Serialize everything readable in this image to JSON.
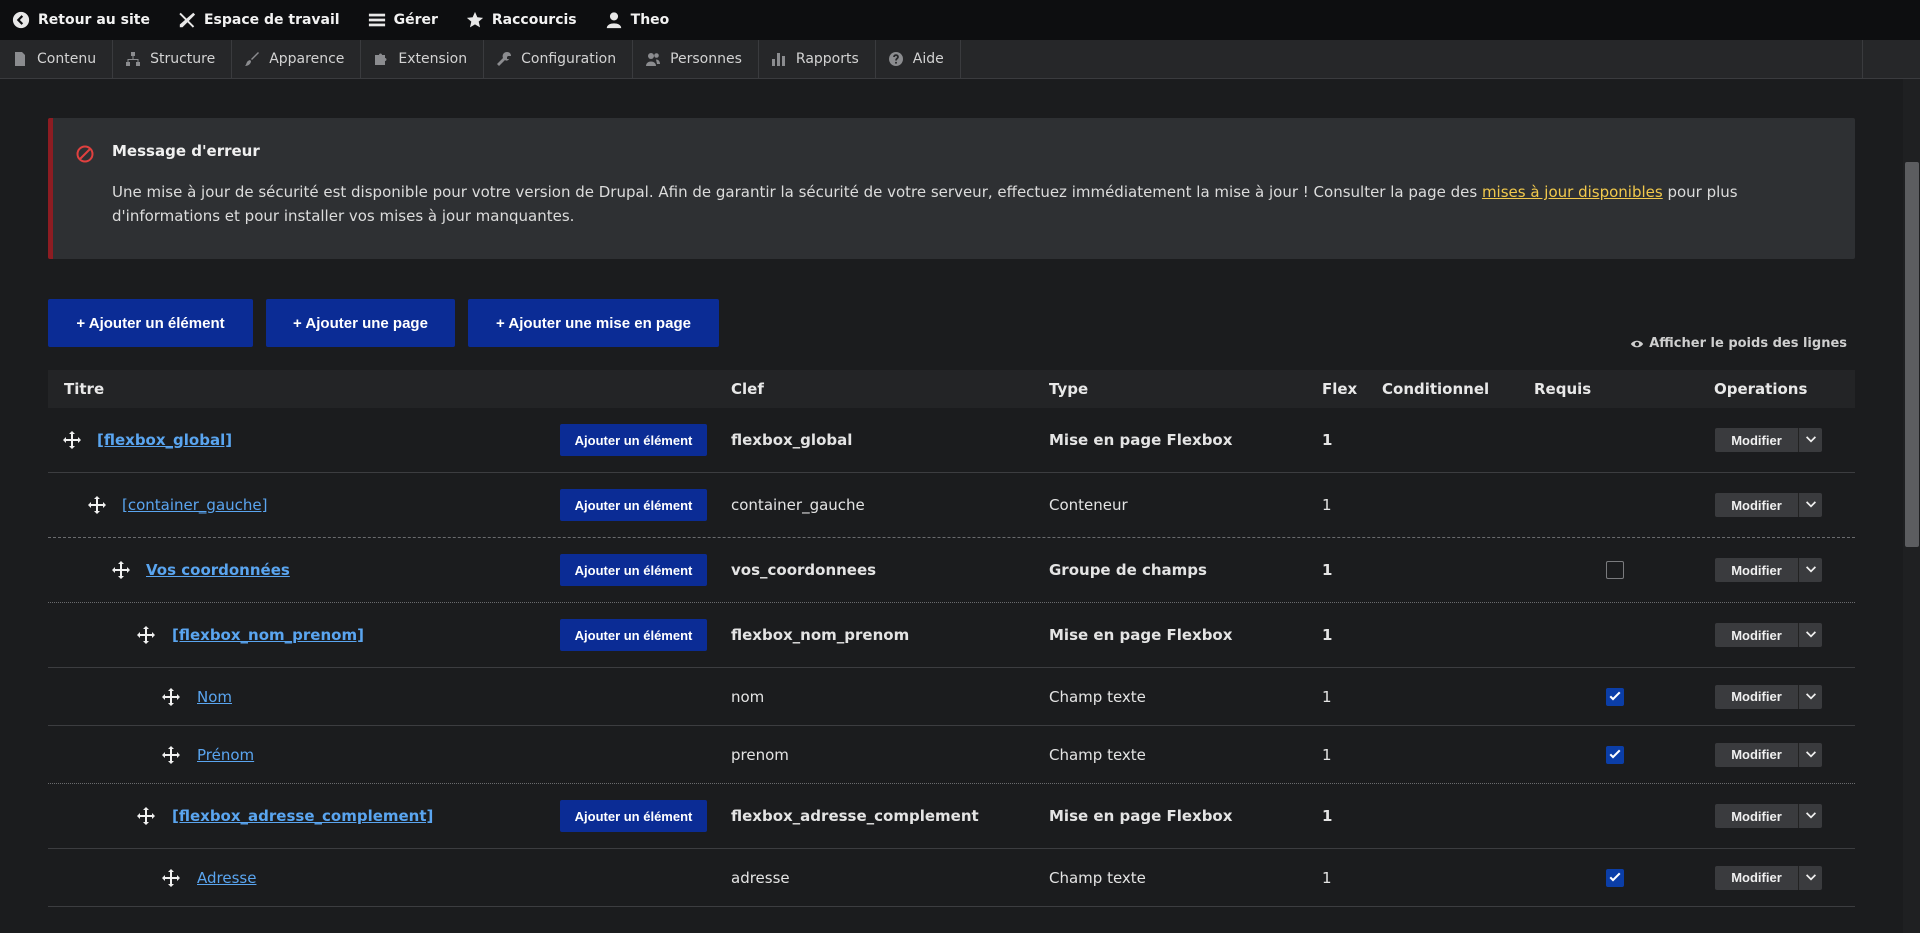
{
  "toolbar": {
    "back": "Retour au site",
    "workspace": "Espace de travail",
    "manage": "Gérer",
    "shortcuts": "Raccourcis",
    "user": "Theo"
  },
  "tray": {
    "items": [
      "Contenu",
      "Structure",
      "Apparence",
      "Extension",
      "Configuration",
      "Personnes",
      "Rapports",
      "Aide"
    ]
  },
  "message": {
    "title": "Message d'erreur",
    "text_before": "Une mise à jour de sécurité est disponible pour votre version de Drupal. Afin de garantir la sécurité de votre serveur, effectuez immédiatement la mise à jour ! Consulter la page des ",
    "link": "mises à jour disponibles",
    "text_after": " pour plus d'informations et pour installer vos mises à jour manquantes."
  },
  "actions": {
    "add_element": "+ Ajouter un élément",
    "add_page": "+ Ajouter une page",
    "add_layout": "+ Ajouter une mise en page",
    "show_weights": "Afficher le poids des lignes"
  },
  "table": {
    "headers": {
      "title": "Titre",
      "key": "Clef",
      "type": "Type",
      "flex": "Flex",
      "conditional": "Conditionnel",
      "required": "Requis",
      "operations": "Operations"
    },
    "add_label": "Ajouter un élément",
    "modify_label": "Modifier",
    "rows": [
      {
        "title": "[flexbox_global]",
        "key": "flexbox_global",
        "type": "Mise en page Flexbox",
        "flex": "1",
        "required": null
      },
      {
        "title": "[container_gauche]",
        "key": "container_gauche",
        "type": "Conteneur",
        "flex": "1",
        "required": null
      },
      {
        "title": "Vos coordonnées",
        "key": "vos_coordonnees",
        "type": "Groupe de champs",
        "flex": "1",
        "required": false
      },
      {
        "title": "[flexbox_nom_prenom]",
        "key": "flexbox_nom_prenom",
        "type": "Mise en page Flexbox",
        "flex": "1",
        "required": null
      },
      {
        "title": "Nom",
        "key": "nom",
        "type": "Champ texte",
        "flex": "1",
        "required": true
      },
      {
        "title": "Prénom",
        "key": "prenom",
        "type": "Champ texte",
        "flex": "1",
        "required": true
      },
      {
        "title": "[flexbox_adresse_complement]",
        "key": "flexbox_adresse_complement",
        "type": "Mise en page Flexbox",
        "flex": "1",
        "required": null
      },
      {
        "title": "Adresse",
        "key": "adresse",
        "type": "Champ texte",
        "flex": "1",
        "required": true
      }
    ]
  },
  "colors": {
    "primary_button": "#0b2c95",
    "link": "#5aa5f0",
    "warning_link": "#f2c94c",
    "error_border": "#8d1c22"
  }
}
